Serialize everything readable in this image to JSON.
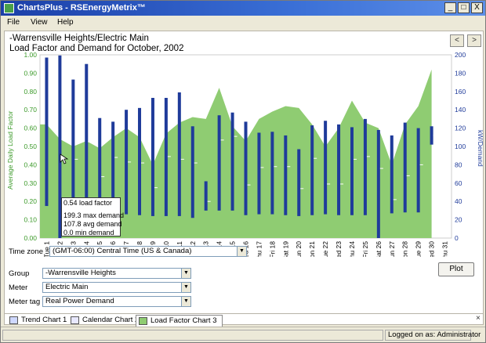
{
  "window": {
    "title": "ChartsPlus - RSEnergyMetrix™",
    "controls": [
      "_",
      "□",
      "X"
    ]
  },
  "menu": [
    "File",
    "View",
    "Help"
  ],
  "nav": {
    "prev": "<",
    "next": ">"
  },
  "chart_title_line1": "-Warrensville Heights/Electric Main",
  "chart_title_line2": "Load Factor and Demand for October, 2002",
  "tooltip": {
    "load_factor": "0.54 load factor",
    "max_demand": "199.3 max demand",
    "avg_demand": "107.8 avg demand",
    "min_demand": "0.0 min demand"
  },
  "chart_data": {
    "type": "area",
    "title": "Load Factor and Demand for October, 2002",
    "ylabel_left": "Average Daily Load Factor",
    "ylabel_right": "kW/Demand",
    "ylim_left": [
      0,
      1.0
    ],
    "ylim_right": [
      0,
      200
    ],
    "y_ticks_left": [
      "0.00",
      "0.10",
      "0.20",
      "0.30",
      "0.40",
      "0.50",
      "0.60",
      "0.70",
      "0.80",
      "0.90",
      "1.00"
    ],
    "y_ticks_right": [
      "0",
      "20",
      "40",
      "60",
      "80",
      "100",
      "120",
      "140",
      "160",
      "180",
      "200"
    ],
    "categories": [
      "Tue 1",
      "Wed 2",
      "Thu 3",
      "Fri 4",
      "Sat 5",
      "Sun 6",
      "Mon 7",
      "Tue 8",
      "Wed 9",
      "Thu 10",
      "Fri 11",
      "Sat 12",
      "Sun 13",
      "Mon 14",
      "Tue 15",
      "Wed 16",
      "Thu 17",
      "Fri 18",
      "Sat 19",
      "Sun 20",
      "Mon 21",
      "Tue 22",
      "Wed 23",
      "Thu 24",
      "Fri 25",
      "Sat 26",
      "Sun 27",
      "Mon 28",
      "Tue 29",
      "Wed 30",
      "Thu 31"
    ],
    "load_factor": [
      0.62,
      0.54,
      0.5,
      0.53,
      0.49,
      0.55,
      0.6,
      0.55,
      0.4,
      0.57,
      0.63,
      0.66,
      0.65,
      0.82,
      0.61,
      0.53,
      0.65,
      0.69,
      0.72,
      0.71,
      0.62,
      0.5,
      0.6,
      0.75,
      0.63,
      0.6,
      0.4,
      0.62,
      0.72,
      0.92,
      null
    ],
    "max_demand": [
      197,
      199.3,
      173,
      190,
      131,
      127,
      140,
      142,
      153,
      153,
      159,
      122,
      62,
      134,
      137,
      127,
      115,
      116,
      112,
      97,
      123,
      128,
      124,
      121,
      130,
      118,
      112,
      126,
      120,
      122,
      null
    ],
    "avg_demand": [
      125,
      107.8,
      86,
      105,
      67,
      88,
      83,
      82,
      55,
      89,
      86,
      82,
      40,
      107,
      111,
      58,
      77,
      78,
      78,
      54,
      87,
      59,
      59,
      86,
      89,
      76,
      42,
      68,
      80,
      112,
      null
    ],
    "min_demand": [
      35,
      0.0,
      30,
      30,
      24,
      25,
      26,
      25,
      24,
      24,
      24,
      22,
      30,
      30,
      30,
      25,
      26,
      26,
      25,
      24,
      25,
      26,
      25,
      25,
      25,
      0,
      27,
      28,
      28,
      102,
      null
    ]
  },
  "form": {
    "timezone_label": "Time zone",
    "timezone_value": "(GMT-06:00) Central Time (US & Canada)",
    "group_label": "Group",
    "group_value": "-Warrensville Heights",
    "meter_label": "Meter",
    "meter_value": "Electric Main",
    "meter_tag_label": "Meter tag",
    "meter_tag_value": "Real Power Demand",
    "plot_label": "Plot"
  },
  "tabs": [
    "Trend Chart 1",
    "Calendar Chart 2",
    "Load Factor Chart 3"
  ],
  "active_tab": 2,
  "tab_close": "×",
  "status": {
    "logged_on": "Logged on as: Administrator"
  },
  "colors": {
    "area": "#8fcc72",
    "bar": "#1f3b9a",
    "left_axis": "#3c9a2a",
    "right_axis": "#1f3b9a"
  }
}
